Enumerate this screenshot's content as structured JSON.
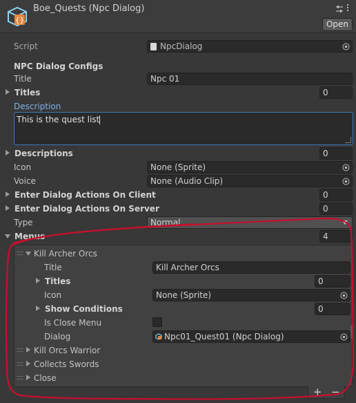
{
  "header": {
    "title": "Boe_Quests (Npc Dialog)",
    "open_label": "Open"
  },
  "script": {
    "label": "Script",
    "value": "NpcDialog"
  },
  "configs": {
    "section_label": "NPC Dialog Configs",
    "title_label": "Title",
    "title_value": "Npc 01",
    "titles_label": "Titles",
    "titles_count": "0",
    "description_label": "Description",
    "description_value": "This is the quest list",
    "descriptions_label": "Descriptions",
    "descriptions_count": "0",
    "icon_label": "Icon",
    "icon_value": "None (Sprite)",
    "voice_label": "Voice",
    "voice_value": "None (Audio Clip)",
    "enter_client_label": "Enter Dialog Actions On Client",
    "enter_client_count": "0",
    "enter_server_label": "Enter Dialog Actions On Server",
    "enter_server_count": "0",
    "type_label": "Type",
    "type_value": "Normal"
  },
  "menus": {
    "label": "Menus",
    "count": "4",
    "expanded": {
      "name": "Kill Archer Orcs",
      "title_label": "Title",
      "title_value": "Kill Archer Orcs",
      "titles_label": "Titles",
      "titles_count": "0",
      "icon_label": "Icon",
      "icon_value": "None (Sprite)",
      "show_conditions_label": "Show Conditions",
      "show_conditions_count": "0",
      "is_close_label": "Is Close Menu",
      "is_close_checked": false,
      "dialog_label": "Dialog",
      "dialog_value": "Npc01_Quest01 (Npc Dialog)"
    },
    "items": [
      "Kill Orcs Warrior",
      "Collects Swords",
      "Close"
    ],
    "add_label": "+",
    "remove_label": "−"
  },
  "colors": {
    "annotation": "#c8102e",
    "accent_label": "#7fb0e8",
    "focus_border": "#3a79bb"
  }
}
